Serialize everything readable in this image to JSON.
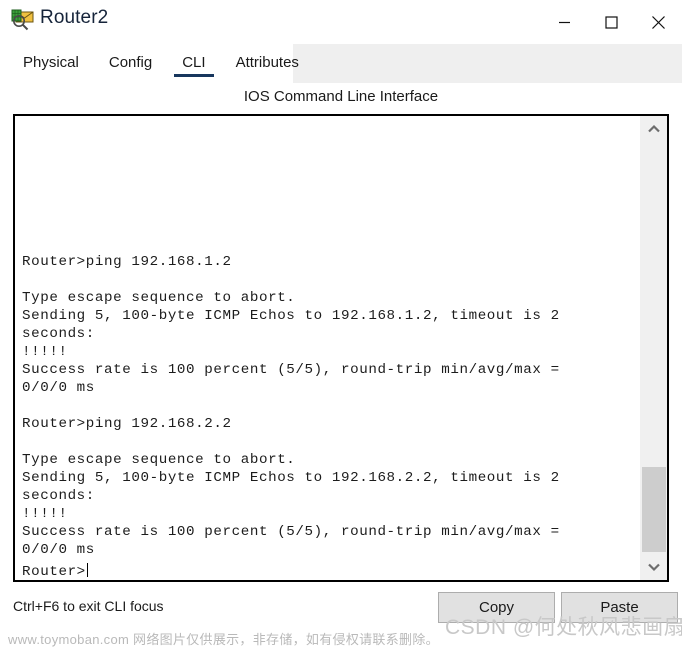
{
  "window": {
    "title": "Router2",
    "icon": "router-magnifier-icon",
    "controls": {
      "minimize": "minimize-icon",
      "maximize": "maximize-icon",
      "close": "close-icon"
    }
  },
  "tabs": [
    {
      "label": "Physical",
      "active": false
    },
    {
      "label": "Config",
      "active": false
    },
    {
      "label": "CLI",
      "active": true
    },
    {
      "label": "Attributes",
      "active": false
    }
  ],
  "cli": {
    "header": "IOS Command Line Interface",
    "prompt_line": "Router>",
    "content": "\n\n\n\n\n\n\nRouter>ping 192.168.1.2\n\nType escape sequence to abort.\nSending 5, 100-byte ICMP Echos to 192.168.1.2, timeout is 2\nseconds:\n!!!!!\nSuccess rate is 100 percent (5/5), round-trip min/avg/max =\n0/0/0 ms\n\nRouter>ping 192.168.2.2\n\nType escape sequence to abort.\nSending 5, 100-byte ICMP Echos to 192.168.2.2, timeout is 2\nseconds:\n!!!!!\nSuccess rate is 100 percent (5/5), round-trip min/avg/max =\n0/0/0 ms\n"
  },
  "scrollbar": {
    "up_arrow": "chevron-up-icon",
    "down_arrow": "chevron-down-icon"
  },
  "footer": {
    "hint": "Ctrl+F6 to exit CLI focus",
    "copy_label": "Copy",
    "paste_label": "Paste"
  },
  "watermarks": {
    "left": "www.toymoban.com 网络图片仅供展示，非存储，如有侵权请联系删除。",
    "right": "CSDN @何处秋风悲画扇"
  },
  "colors": {
    "active_tab_underline": "#17365d",
    "title_text": "#16243a",
    "tabstrip_bg": "#efefef",
    "button_bg": "#e1e1e1",
    "scroll_thumb": "#cdcdcd"
  }
}
